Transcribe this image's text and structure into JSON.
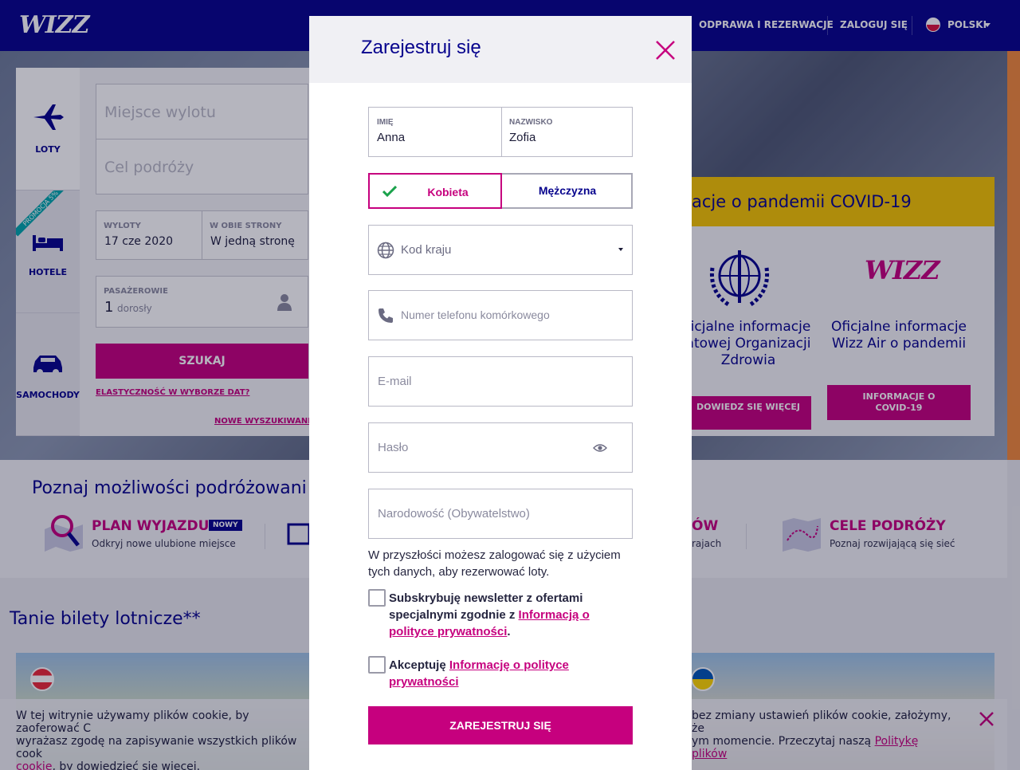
{
  "header": {
    "logo": "WIZZ",
    "nav": [
      "ODPRAWA I REZERWACJE",
      "ZALOGUJ SIĘ"
    ],
    "language": "POLSKI"
  },
  "search": {
    "tabs": [
      "LOTY",
      "HOTELE",
      "SAMOCHODY"
    ],
    "promo_ribbon": "PROMOCJA 5%",
    "origin_placeholder": "Miejsce wylotu",
    "destination_placeholder": "Cel podróży",
    "departure_label": "WYLOTY",
    "departure_value": "17 cze 2020",
    "trip_label": "W OBIE STRONY",
    "trip_value": "W jedną stronę",
    "passengers_label": "PASAŻEROWIE",
    "passengers_count": "1",
    "passengers_type": "dorosły",
    "search_button": "SZUKAJ",
    "flex_link": "ELASTYCZNOŚĆ W WYBORZE DAT?",
    "new_search_link": "NOWE WYSZUKIWANIE"
  },
  "covid": {
    "title": "acje o pandemii COVID-19",
    "who_text": "ficjalne informacje\natowej Organizacji\nZdrowia",
    "who_button": "DOWIEDZ SIĘ WIĘCEJ",
    "wizz_text": "Oficjalne informacje\nWizz Air o pandemii",
    "wizz_button": "INFORMACJE O\nCOVID-19"
  },
  "explore": {
    "title": "Poznaj możliwości podróżowani",
    "plan_title": "PLAN WYJAZDU",
    "plan_badge": "NOWY",
    "plan_sub": "Odkryj nowe ulubione miejsce",
    "mid_title": "ÓW",
    "mid_sub": "rajach",
    "dest_title": "CELE PODRÓŻY",
    "dest_sub": "Poznaj rozwijającą się sieć"
  },
  "cheap": {
    "title": "Tanie bilety lotnicze**"
  },
  "cookie": {
    "text_left": "W tej witrynie używamy plików cookie, by zaoferować C",
    "text_left2": "wyrażasz zgodę na zapisywanie wszystkich plików cook",
    "link_left": "cookie",
    "text_left3": ", by dowiedzieć się więcej.",
    "text_right": "bez zmiany ustawień plików cookie, założymy, że",
    "text_right2": "ym momencie. Przeczytaj naszą ",
    "link_right": "Politykę plików"
  },
  "modal": {
    "title": "Zarejestruj się",
    "first_name_label": "IMIĘ",
    "first_name_value": "Anna",
    "last_name_label": "NAZWISKO",
    "last_name_value": "Zofia",
    "gender_female": "Kobieta",
    "gender_male": "Mężczyzna",
    "country_code_placeholder": "Kod kraju",
    "phone_placeholder": "Numer telefonu komórkowego",
    "email_placeholder": "E-mail",
    "password_placeholder": "Hasło",
    "nationality_placeholder": "Narodowość (Obywatelstwo)",
    "info_text": "W przyszłości możesz zalogować się z użyciem tych danych, aby rezerwować loty.",
    "newsletter_text": "Subskrybuję newsletter z ofertami specjalnymi zgodnie z ",
    "newsletter_link": "Informacją o polityce prywatności",
    "newsletter_end": ".",
    "accept_text": "Akceptuję ",
    "accept_link": "Informację o polityce prywatności",
    "submit_button": "ZAREJESTRUJ SIĘ"
  },
  "colors": {
    "brand_navy": "#06038d",
    "brand_magenta": "#c6007e",
    "success_green": "#1aa24b",
    "covid_yellow": "#f5c400"
  }
}
